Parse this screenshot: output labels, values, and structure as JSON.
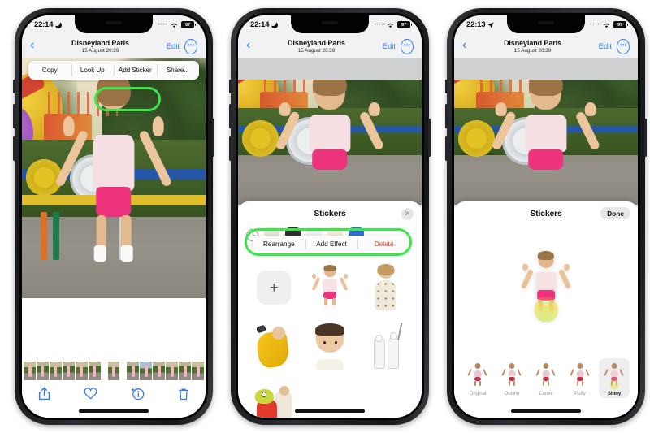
{
  "phones": [
    {
      "id": "phone-1",
      "status": {
        "time": "22:14",
        "indicator_icon": "moon-icon",
        "cellular_icon": "cellular-dots-icon",
        "wifi_icon": "wifi-icon",
        "battery": "97"
      },
      "nav": {
        "back_icon": "chevron-left-icon",
        "title": "Disneyland Paris",
        "subtitle": "15 August  20:39",
        "edit_label": "Edit",
        "more_icon": "ellipsis-circle-icon"
      },
      "context_menu": {
        "items": [
          "Copy",
          "Look Up",
          "Add Sticker",
          "Share..."
        ],
        "highlighted": "Add Sticker",
        "highlight_color": "#3ce64a"
      },
      "toolbar": {
        "icons": [
          "share-icon",
          "heart-icon",
          "info-sparkle-icon",
          "trash-icon"
        ],
        "tint": "#2f7cf6"
      },
      "filmstrip_label": "photo-filmstrip"
    },
    {
      "id": "phone-2",
      "status": {
        "time": "22:14",
        "indicator_icon": "moon-icon",
        "cellular_icon": "cellular-dots-icon",
        "wifi_icon": "wifi-icon",
        "battery": "97"
      },
      "nav": {
        "back_icon": "chevron-left-icon",
        "title": "Disneyland Paris",
        "subtitle": "15 August  20:39",
        "edit_label": "Edit",
        "more_icon": "ellipsis-circle-icon"
      },
      "sheet": {
        "title": "Stickers",
        "close_icon": "close-x-icon",
        "recents_icon": "clock-icon"
      },
      "context_menu": {
        "items": [
          "Rearrange",
          "Add Effect",
          "Delete"
        ],
        "destructive": "Delete",
        "destructive_color": "#ef3b2f",
        "highlight_color": "#3ce64a"
      },
      "stickers": {
        "add_label": "+",
        "items": [
          "sticker-jumping-kid",
          "sticker-pajama-kid",
          "sticker-yellow-raincoat",
          "sticker-baby-face",
          "sticker-stormtroopers",
          "sticker-turtle-costume"
        ]
      }
    },
    {
      "id": "phone-3",
      "status": {
        "time": "22:13",
        "indicator_icon": "location-arrow-icon",
        "cellular_icon": "cellular-dots-icon",
        "wifi_icon": "wifi-icon",
        "battery": "97"
      },
      "nav": {
        "back_icon": "chevron-left-icon",
        "title": "Disneyland Paris",
        "subtitle": "15 August  20:39",
        "edit_label": "Edit",
        "more_icon": "ellipsis-circle-icon"
      },
      "sheet": {
        "title": "Stickers",
        "done_label": "Done"
      },
      "preview": {
        "sticker": "sticker-jumping-kid-shiny"
      },
      "effects": [
        {
          "label": "Original",
          "selected": false
        },
        {
          "label": "Outline",
          "selected": false
        },
        {
          "label": "Comic",
          "selected": false
        },
        {
          "label": "Puffy",
          "selected": false
        },
        {
          "label": "Shiny",
          "selected": true
        }
      ]
    }
  ]
}
